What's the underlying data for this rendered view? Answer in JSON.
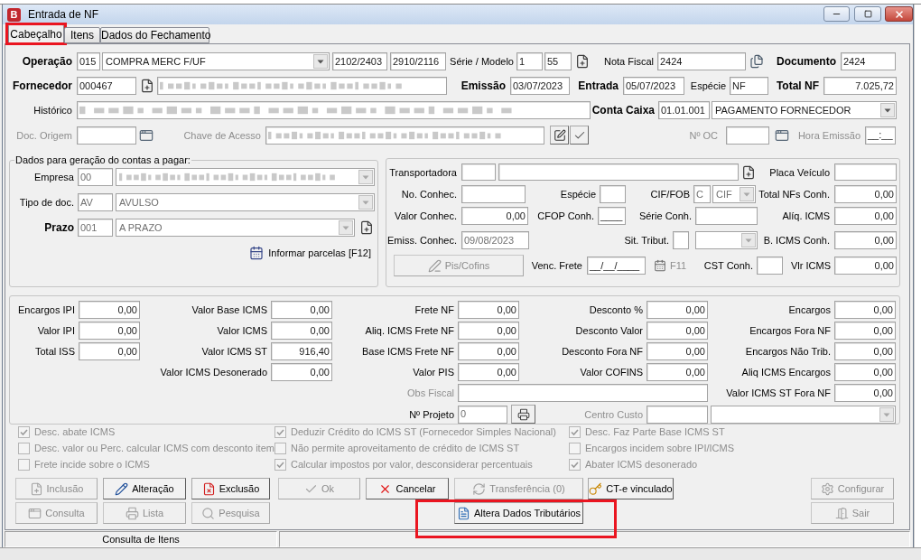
{
  "window": {
    "title": "Entrada de NF",
    "icon_letter": "B"
  },
  "tabs": [
    {
      "label": "Cabeçalho",
      "selected": true,
      "highlighted": true
    },
    {
      "label": "Itens",
      "selected": false,
      "highlighted": false
    },
    {
      "label": "Dados do Fechamento",
      "selected": false,
      "highlighted": false
    }
  ],
  "header": {
    "operacao": {
      "label": "Operação",
      "code": "015",
      "description": "COMPRA MERC F/UF",
      "field_3": "2102/2403",
      "field_4": "2910/2116"
    },
    "serie_modelo": {
      "label": "Série / Modelo",
      "serie": "1",
      "modelo": "55"
    },
    "nota_fiscal": {
      "label": "Nota Fiscal",
      "value": "2424"
    },
    "documento": {
      "label": "Documento",
      "value": "2424"
    },
    "fornecedor": {
      "label": "Fornecedor",
      "code": "000467",
      "name_obscured": true
    },
    "emissao": {
      "label": "Emissão",
      "value": "03/07/2023"
    },
    "entrada": {
      "label": "Entrada",
      "value": "05/07/2023"
    },
    "especie": {
      "label": "Espécie",
      "value": "NF"
    },
    "total_nf": {
      "label": "Total NF",
      "value": "7.025,72"
    },
    "historico": {
      "label": "Histórico",
      "obscured": true
    },
    "conta_caixa": {
      "label": "Conta Caixa",
      "code": "01.01.001",
      "description": "PAGAMENTO FORNECEDOR"
    },
    "doc_origem": {
      "label": "Doc. Origem",
      "disabled": true
    },
    "chave_acesso": {
      "label": "Chave de Acesso",
      "disabled": true,
      "obscured": true
    },
    "numero_oc": {
      "label": "Nº OC",
      "disabled": true
    },
    "hora_emissao": {
      "label": "Hora Emissão",
      "value": "__:__",
      "disabled": true
    }
  },
  "contas_a_pagar": {
    "title": "Dados para geração do contas a pagar:",
    "empresa": {
      "label": "Empresa",
      "code": "00",
      "disabled": true,
      "name_obscured": true
    },
    "tipo_doc": {
      "label": "Tipo de doc.",
      "code": "AV",
      "description": "AVULSO",
      "disabled": true
    },
    "prazo": {
      "label": "Prazo",
      "code": "001",
      "description": "A PRAZO",
      "disabled": true
    },
    "parcelas_link": "Informar parcelas [F12]"
  },
  "frete": {
    "transportadora": {
      "label": "Transportadora"
    },
    "placa_veiculo": {
      "label": "Placa Veículo"
    },
    "no_conhec": {
      "label": "No. Conhec."
    },
    "especie": {
      "label": "Espécie"
    },
    "cif_fob": {
      "label": "CIF/FOB",
      "code": "C",
      "description": "CIF",
      "disabled": true
    },
    "total_nfs_conh": {
      "label": "Total NFs Conh.",
      "value": "0,00"
    },
    "valor_conhec": {
      "label": "Valor Conhec.",
      "value": "0,00"
    },
    "cfop_conh": {
      "label": "CFOP Conh.",
      "value": "____"
    },
    "serie_conh": {
      "label": "Série Conh."
    },
    "aliq_icms": {
      "label": "Alíq. ICMS",
      "value": "0,00"
    },
    "emiss_conhec": {
      "label": "Emiss. Conhec.",
      "value": "09/08/2023",
      "disabled": true
    },
    "sit_tribut": {
      "label": "Sit. Tribut.",
      "combo_disabled": true
    },
    "b_icms_conh": {
      "label": "B. ICMS Conh.",
      "value": "0,00"
    },
    "pis_cofins_button": {
      "label": "Pis/Cofins",
      "disabled": true
    },
    "venc_frete": {
      "label": "Venc. Frete",
      "value": "__/__/____"
    },
    "f11_shortcut": {
      "label": "F11",
      "disabled": true
    },
    "cst_conh": {
      "label": "CST Conh."
    },
    "vlr_icms": {
      "label": "Vlr ICMS",
      "value": "0,00"
    }
  },
  "totais": {
    "columns": [
      [
        {
          "label": "Encargos IPI",
          "value": "0,00"
        },
        {
          "label": "Valor IPI",
          "value": "0,00"
        },
        {
          "label": "Total ISS",
          "value": "0,00"
        }
      ],
      [
        {
          "label": "Valor Base ICMS",
          "value": "0,00"
        },
        {
          "label": "Valor ICMS",
          "value": "0,00"
        },
        {
          "label": "Valor ICMS ST",
          "value": "916,40"
        },
        {
          "label": "Valor ICMS Desonerado",
          "value": "0,00"
        }
      ],
      [
        {
          "label": "Frete NF",
          "value": "0,00"
        },
        {
          "label": "Aliq. ICMS Frete NF",
          "value": "0,00"
        },
        {
          "label": "Base ICMS Frete NF",
          "value": "0,00"
        },
        {
          "label": "Valor PIS",
          "value": "0,00"
        }
      ],
      [
        {
          "label": "Desconto %",
          "value": "0,00"
        },
        {
          "label": "Desconto Valor",
          "value": "0,00"
        },
        {
          "label": "Desconto Fora NF",
          "value": "0,00"
        },
        {
          "label": "Valor COFINS",
          "value": "0,00"
        }
      ],
      [
        {
          "label": "Encargos",
          "value": "0,00"
        },
        {
          "label": "Encargos Fora NF",
          "value": "0,00"
        },
        {
          "label": "Encargos Não Trib.",
          "value": "0,00"
        },
        {
          "label": "Aliq ICMS Encargos",
          "value": "0,00"
        },
        {
          "label": "Valor ICMS ST Fora NF",
          "value": "0,00"
        }
      ]
    ],
    "obs_fiscal": {
      "label": "Obs Fiscal",
      "disabled": true
    },
    "projeto": {
      "label": "Nº Projeto",
      "value": "0",
      "disabled": true
    },
    "centro_custo": {
      "label": "Centro Custo",
      "disabled": true
    }
  },
  "options": [
    [
      {
        "label": "Desc. abate ICMS",
        "checked": true,
        "disabled": true
      },
      {
        "label": "Desc. valor ou Perc. calcular ICMS com desconto item",
        "checked": false,
        "disabled": true
      },
      {
        "label": "Frete incide sobre o ICMS",
        "checked": false,
        "disabled": true
      }
    ],
    [
      {
        "label": "Deduzir Crédito do ICMS ST (Fornecedor Simples Nacional)",
        "checked": true,
        "disabled": true
      },
      {
        "label": "Não permite aproveitamento de crédito de ICMS ST",
        "checked": false,
        "disabled": true
      },
      {
        "label": "Calcular impostos por valor, desconsiderar percentuais",
        "checked": true,
        "disabled": true
      }
    ],
    [
      {
        "label": "Desc. Faz Parte Base ICMS ST",
        "checked": true,
        "disabled": true
      },
      {
        "label": "Encargos incidem sobre IPI/ICMS",
        "checked": false,
        "disabled": true
      },
      {
        "label": "Abater ICMS desonerado",
        "checked": true,
        "disabled": true
      }
    ]
  ],
  "buttons": {
    "row_1": [
      {
        "label": "Inclusão",
        "disabled": true,
        "highlighted": false
      },
      {
        "label": "Alteração",
        "disabled": false,
        "highlighted": false
      },
      {
        "label": "Exclusão",
        "disabled": false,
        "highlighted": false
      },
      {
        "label": "Ok",
        "disabled": true,
        "highlighted": false
      },
      {
        "label": "Cancelar",
        "disabled": false,
        "highlighted": false
      },
      {
        "label": "Transferência (0)",
        "disabled": true,
        "highlighted": false
      },
      {
        "label": "CT-e vinculado",
        "disabled": false,
        "highlighted": false
      },
      {
        "label": "Configurar",
        "disabled": true,
        "highlighted": false
      }
    ],
    "row_2": [
      {
        "label": "Consulta",
        "disabled": true,
        "highlighted": false
      },
      {
        "label": "Lista",
        "disabled": true,
        "highlighted": false
      },
      {
        "label": "Pesquisa",
        "disabled": true,
        "highlighted": false
      },
      {
        "label": "Altera Dados Tributários",
        "disabled": false,
        "highlighted": true
      },
      {
        "label": "Sair",
        "disabled": true,
        "highlighted": false
      }
    ]
  },
  "status_bar": {
    "text": "Consulta de Itens"
  }
}
